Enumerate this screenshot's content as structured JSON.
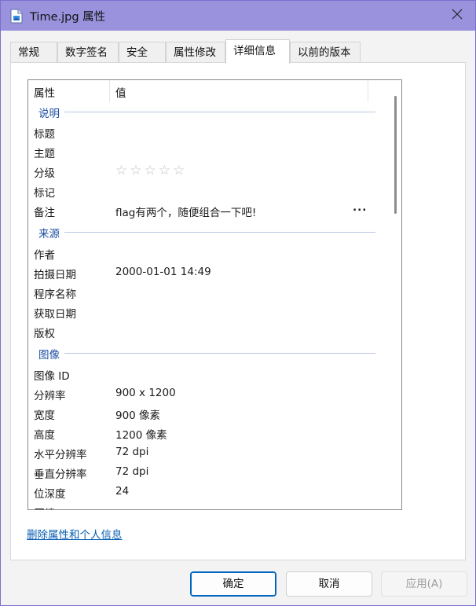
{
  "window": {
    "title": "Time.jpg 属性",
    "icon": "image-file-icon"
  },
  "tabs": [
    {
      "label": "常规",
      "active": false
    },
    {
      "label": "数字签名",
      "active": false
    },
    {
      "label": "安全",
      "active": false
    },
    {
      "label": "属性修改",
      "active": false
    },
    {
      "label": "详细信息",
      "active": true
    },
    {
      "label": "以前的版本",
      "active": false
    }
  ],
  "details": {
    "col_property": "属性",
    "col_value": "值",
    "groups": [
      {
        "label": "说明",
        "rows": [
          {
            "key": "标题",
            "value": ""
          },
          {
            "key": "主题",
            "value": ""
          },
          {
            "key": "分级",
            "value": "",
            "stars": "☆☆☆☆☆",
            "rating": 0
          },
          {
            "key": "标记",
            "value": ""
          },
          {
            "key": "备注",
            "value": "flag有两个，随便组合一下吧!",
            "more": "..."
          }
        ]
      },
      {
        "label": "来源",
        "rows": [
          {
            "key": "作者",
            "value": ""
          },
          {
            "key": "拍摄日期",
            "value": "2000-01-01 14:49"
          },
          {
            "key": "程序名称",
            "value": ""
          },
          {
            "key": "获取日期",
            "value": ""
          },
          {
            "key": "版权",
            "value": ""
          }
        ]
      },
      {
        "label": "图像",
        "rows": [
          {
            "key": "图像 ID",
            "value": ""
          },
          {
            "key": "分辨率",
            "value": "900 x 1200"
          },
          {
            "key": "宽度",
            "value": "900 像素"
          },
          {
            "key": "高度",
            "value": "1200 像素"
          },
          {
            "key": "水平分辨率",
            "value": "72 dpi"
          },
          {
            "key": "垂直分辨率",
            "value": "72 dpi"
          },
          {
            "key": "位深度",
            "value": "24"
          },
          {
            "key": "压缩",
            "value": ""
          }
        ]
      }
    ]
  },
  "link_remove": "删除属性和个人信息",
  "buttons": {
    "ok": "确定",
    "cancel": "取消",
    "apply": "应用(A)"
  }
}
